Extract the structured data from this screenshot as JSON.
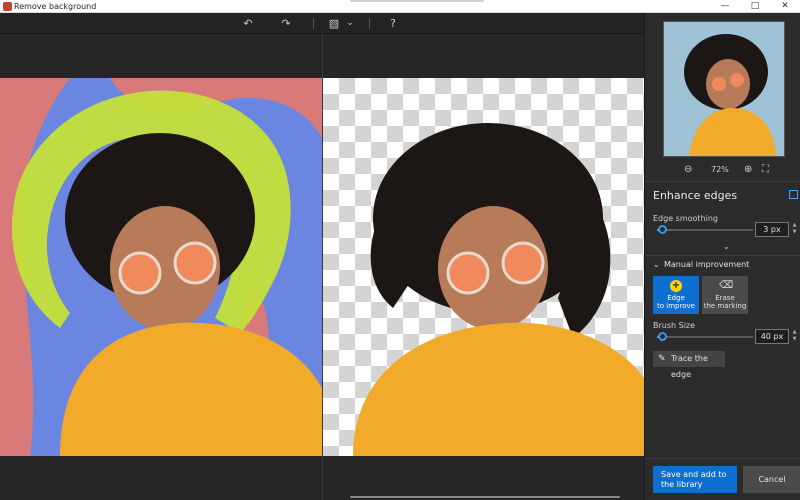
{
  "window": {
    "title": "Remove background",
    "minimize": "—",
    "maximize": "□",
    "close": "✕"
  },
  "toolbar": {
    "undo": "↶",
    "redo": "↷",
    "image_mode": "▧",
    "dropdown": "⌄",
    "help": "?"
  },
  "panel": {
    "zoom": {
      "zoom_out": "⊖",
      "level": "72%",
      "zoom_in": "⊕",
      "fit": "⛶"
    },
    "enhance_title": "Enhance edges",
    "edge_smoothing": {
      "label": "Edge smoothing",
      "value": "3 px",
      "fraction": 0.05
    },
    "expand": "⌄",
    "manual": {
      "chevron": "⌄",
      "title": "Manual improvement"
    },
    "modes": [
      {
        "glyph": "+",
        "line1": "Edge",
        "line2": "to improve"
      },
      {
        "glyph": "⌫",
        "line1": "Erase",
        "line2": "the marking"
      }
    ],
    "brush_size": {
      "label": "Brush Size",
      "value": "40 px",
      "fraction": 0.05
    },
    "trace": {
      "icon": "✎",
      "label": "Trace the edge"
    },
    "save": "Save and add to the library",
    "cancel": "Cancel"
  },
  "colors": {
    "accent": "#0f6fd1",
    "highlight": "#ffd400",
    "marking": "#c4e03a",
    "background_mark": "#d97a7a",
    "sweater": "#f2aa2a"
  }
}
